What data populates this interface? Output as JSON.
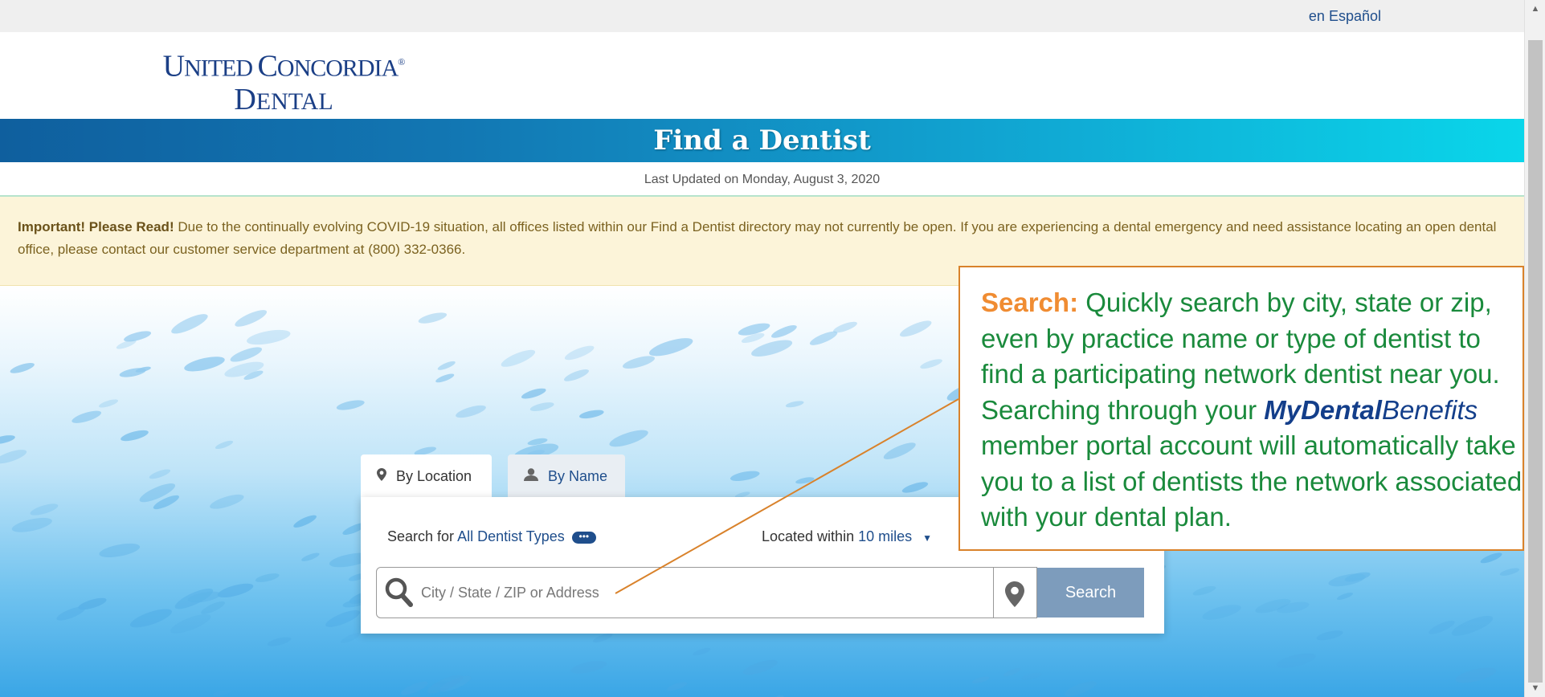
{
  "topbar": {
    "language_link": "en Español"
  },
  "logo": {
    "line1_big1": "U",
    "line1_small1": "NITED ",
    "line1_big2": "C",
    "line1_small2": "ONCORDIA",
    "reg": "®",
    "line2_big": "D",
    "line2_small": "ENTAL"
  },
  "page_title": "Find a Dentist",
  "last_updated": "Last Updated on Monday, August 3, 2020",
  "notice": {
    "lead": "Important! Please Read!",
    "body": " Due to the continually evolving COVID-19 situation, all offices listed within our Find a Dentist directory may not currently be open. If you are experiencing a dental emergency and need assistance locating an open dental office, please contact our customer service department at (800) 332-0366."
  },
  "search": {
    "tabs": [
      {
        "label": "By Location",
        "icon": "map-pin-icon"
      },
      {
        "label": "By Name",
        "icon": "person-icon"
      }
    ],
    "search_for_label": "Search for",
    "search_for_value": "All Dentist Types",
    "search_for_badge": "•••",
    "located_within_label": "Located within",
    "located_within_value": "10 miles",
    "input_placeholder": "City / State / ZIP or Address",
    "button_label": "Search"
  },
  "callout": {
    "lead": "Search:",
    "line1": " Quickly search by city, state or zip,",
    "line2": "even by practice name or type of dentist to",
    "line3": "find a participating network dentist near you.",
    "line4_pre": "Searching through your ",
    "line4_brand_bold": "MyDental",
    "line4_brand_italic": "Benefits",
    "line5": "member portal account will automatically take",
    "line6": "you to a list of dentists the network associated",
    "line7": "with your dental plan."
  },
  "colors": {
    "brand_blue": "#1b3f86",
    "link_blue": "#1f4e8c",
    "callout_border": "#d9822b",
    "callout_text": "#1a8a3c",
    "callout_lead": "#f08c32",
    "search_button": "#7d9cbc"
  }
}
